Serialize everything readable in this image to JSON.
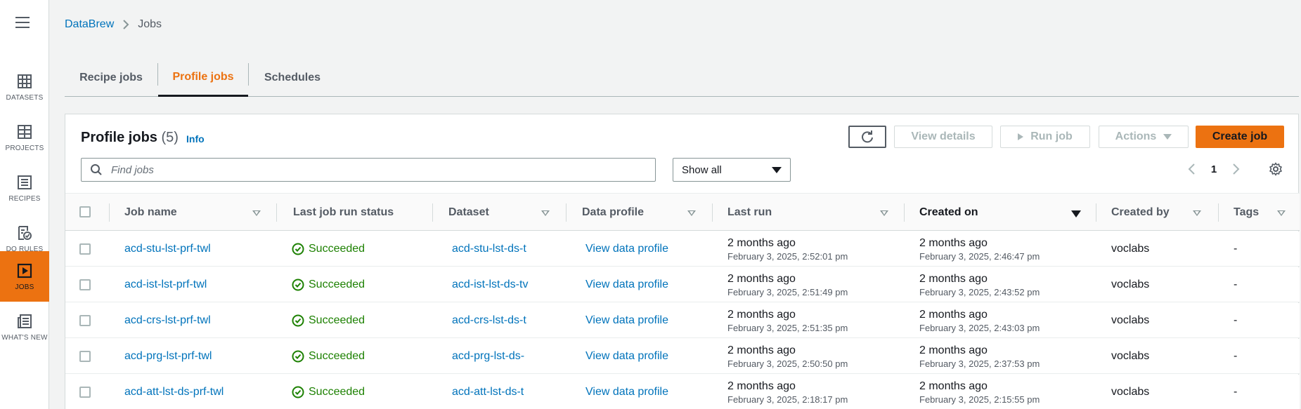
{
  "rail": {
    "items": [
      {
        "label": "DATASETS",
        "icon": "table-icon"
      },
      {
        "label": "PROJECTS",
        "icon": "grid-icon"
      },
      {
        "label": "RECIPES",
        "icon": "list-icon"
      },
      {
        "label": "DQ RULES",
        "icon": "checklist-icon"
      },
      {
        "label": "JOBS",
        "icon": "play-icon",
        "active": true
      },
      {
        "label": "WHAT'S NEW",
        "icon": "news-icon"
      }
    ]
  },
  "breadcrumb": {
    "parent": "DataBrew",
    "current": "Jobs"
  },
  "tabs": [
    {
      "label": "Recipe jobs"
    },
    {
      "label": "Profile jobs",
      "active": true
    },
    {
      "label": "Schedules"
    }
  ],
  "panel": {
    "title": "Profile jobs",
    "count": "(5)",
    "info": "Info",
    "buttons": {
      "view_details": "View details",
      "run_job": "Run job",
      "actions": "Actions",
      "create_job": "Create job"
    },
    "search_placeholder": "Find jobs",
    "filter_value": "Show all",
    "page": "1"
  },
  "columns": {
    "job_name": "Job name",
    "status": "Last job run status",
    "dataset": "Dataset",
    "profile": "Data profile",
    "last_run": "Last run",
    "created_on": "Created on",
    "created_by": "Created by",
    "tags": "Tags"
  },
  "rows": [
    {
      "job_name": "acd-stu-lst-prf-twl",
      "status": "Succeeded",
      "dataset": "acd-stu-lst-ds-t",
      "profile": "View data profile",
      "last_run": "2 months ago",
      "last_run_date": "February 3, 2025, 2:52:01 pm",
      "created_on": "2 months ago",
      "created_on_date": "February 3, 2025, 2:46:47 pm",
      "created_by": "voclabs",
      "tags": "-"
    },
    {
      "job_name": "acd-ist-lst-prf-twl",
      "status": "Succeeded",
      "dataset": "acd-ist-lst-ds-tv",
      "profile": "View data profile",
      "last_run": "2 months ago",
      "last_run_date": "February 3, 2025, 2:51:49 pm",
      "created_on": "2 months ago",
      "created_on_date": "February 3, 2025, 2:43:52 pm",
      "created_by": "voclabs",
      "tags": "-"
    },
    {
      "job_name": "acd-crs-lst-prf-twl",
      "status": "Succeeded",
      "dataset": "acd-crs-lst-ds-t",
      "profile": "View data profile",
      "last_run": "2 months ago",
      "last_run_date": "February 3, 2025, 2:51:35 pm",
      "created_on": "2 months ago",
      "created_on_date": "February 3, 2025, 2:43:03 pm",
      "created_by": "voclabs",
      "tags": "-"
    },
    {
      "job_name": "acd-prg-lst-prf-twl",
      "status": "Succeeded",
      "dataset": "acd-prg-lst-ds-",
      "profile": "View data profile",
      "last_run": "2 months ago",
      "last_run_date": "February 3, 2025, 2:50:50 pm",
      "created_on": "2 months ago",
      "created_on_date": "February 3, 2025, 2:37:53 pm",
      "created_by": "voclabs",
      "tags": "-"
    },
    {
      "job_name": "acd-att-lst-ds-prf-twl",
      "status": "Succeeded",
      "dataset": "acd-att-lst-ds-t",
      "profile": "View data profile",
      "last_run": "2 months ago",
      "last_run_date": "February 3, 2025, 2:18:17 pm",
      "created_on": "2 months ago",
      "created_on_date": "February 3, 2025, 2:15:55 pm",
      "created_by": "voclabs",
      "tags": "-"
    }
  ]
}
